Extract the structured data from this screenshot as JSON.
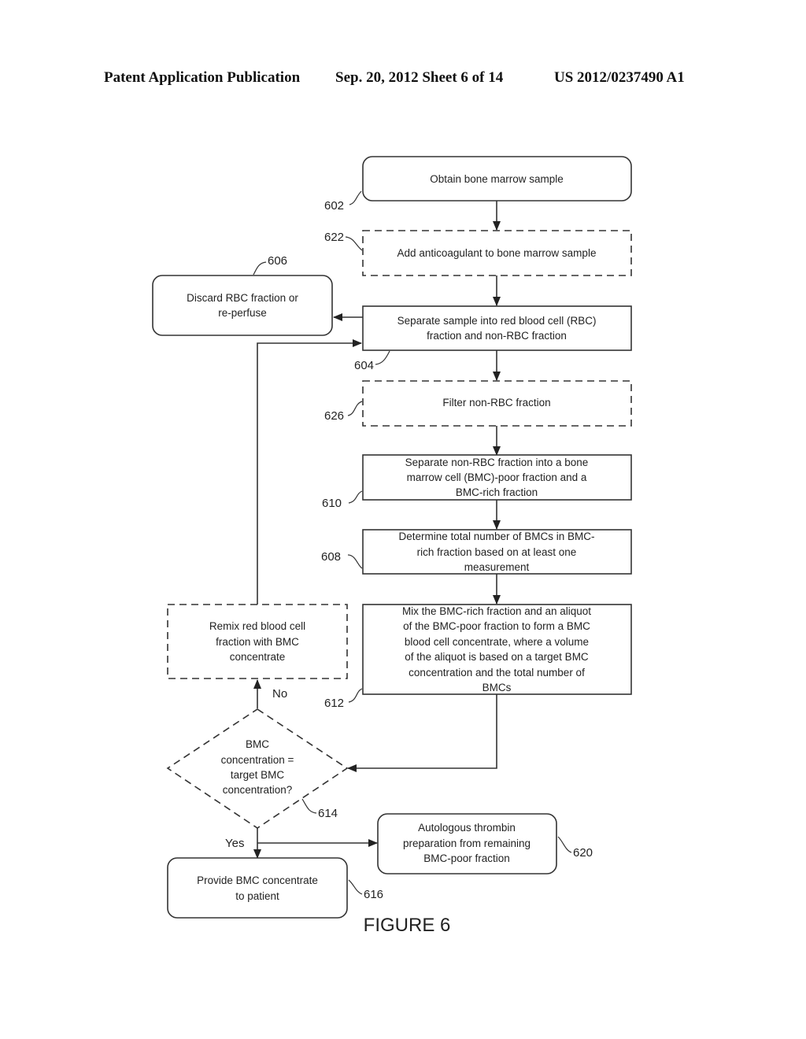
{
  "header": {
    "publication": "Patent Application Publication",
    "date_sheet": "Sep. 20, 2012   Sheet 6 of 14",
    "number": "US 2012/0237490 A1"
  },
  "figure_label": "FIGURE 6",
  "steps": {
    "s602": {
      "ref": "602",
      "lines": [
        "Obtain bone marrow sample"
      ],
      "style": "rounded"
    },
    "s622": {
      "ref": "622",
      "lines": [
        "Add anticoagulant to bone marrow sample"
      ],
      "style": "dashed"
    },
    "s604": {
      "ref": "604",
      "lines": [
        "Separate sample into red blood cell (RBC)",
        "fraction and non-RBC fraction"
      ],
      "style": "solid"
    },
    "s606": {
      "ref": "606",
      "lines": [
        "Discard RBC fraction or",
        "re-perfuse"
      ],
      "style": "rounded"
    },
    "s626": {
      "ref": "626",
      "lines": [
        "Filter non-RBC fraction"
      ],
      "style": "dashed"
    },
    "s610": {
      "ref": "610",
      "lines": [
        "Separate non-RBC fraction into a bone",
        "marrow cell (BMC)-poor fraction and a",
        "BMC-rich fraction"
      ],
      "style": "solid"
    },
    "s608": {
      "ref": "608",
      "lines": [
        "Determine total number of BMCs in BMC-",
        "rich fraction based on at least one",
        "measurement"
      ],
      "style": "solid"
    },
    "s612": {
      "ref": "612",
      "lines": [
        "Mix the BMC-rich fraction and an aliquot",
        "of the BMC-poor fraction to form a BMC",
        "blood cell concentrate, where a volume",
        "of the aliquot is based on a target BMC",
        "concentration and the total number of",
        "BMCs"
      ],
      "style": "solid"
    },
    "s618": {
      "lines": [
        "Remix red blood cell",
        "fraction with BMC",
        "concentrate"
      ],
      "style": "dashed"
    },
    "s614": {
      "ref": "614",
      "lines": [
        "BMC",
        "concentration =",
        "target BMC",
        "concentration?"
      ],
      "style": "dashed-diamond"
    },
    "s616": {
      "ref": "616",
      "lines": [
        "Provide BMC concentrate",
        "to patient"
      ],
      "style": "rounded"
    },
    "s620": {
      "ref": "620",
      "lines": [
        "Autologous thrombin",
        "preparation from remaining",
        "BMC-poor fraction"
      ],
      "style": "rounded"
    }
  },
  "branch_labels": {
    "no": "No",
    "yes": "Yes"
  }
}
